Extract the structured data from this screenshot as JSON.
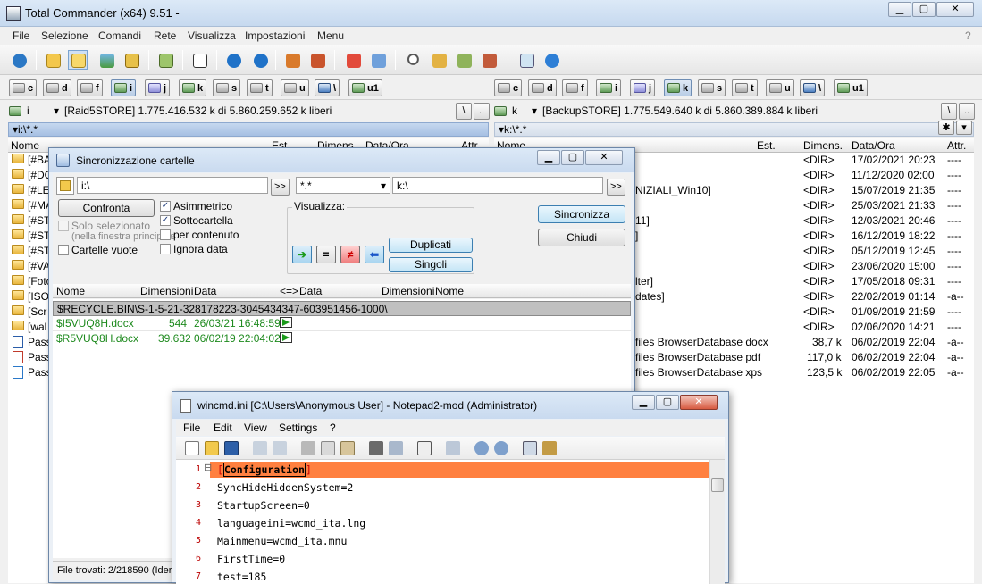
{
  "main": {
    "title": "Total Commander (x64) 9.51 - ",
    "menu": [
      "File",
      "Selezione",
      "Comandi",
      "Rete",
      "Visualizza",
      "Impostazioni",
      "Menu"
    ],
    "help_mark": "?",
    "drives": [
      "c",
      "d",
      "f",
      "i",
      "j",
      "k",
      "s",
      "t",
      "u",
      "\\",
      "u1"
    ],
    "left": {
      "drive": "i",
      "free": "[Raid5STORE]  1.775.416.532 k di 5.860.259.652 k liberi",
      "path": "i:\\*.*",
      "cols": [
        "Nome",
        "Est.",
        "Dimens.",
        "Data/Ora",
        "Attr."
      ],
      "rows": [
        "[#BA",
        "[#DO",
        "[#LE",
        "[#MA",
        "[#ST",
        "[#ST",
        "[#ST",
        "[#VA",
        "[Foto",
        "[ISO",
        "[Scr",
        "[wal",
        "Pass",
        "Pass",
        "Pass"
      ]
    },
    "right": {
      "drive": "k",
      "free": "[BackupSTORE]  1.775.549.640 k di 5.860.389.884 k liberi",
      "path": "k:\\*.*",
      "cols": [
        "Nome",
        "Est.",
        "Dimens.",
        "Data/Ora",
        "Attr."
      ],
      "rows": [
        {
          "name": "",
          "size": "<DIR>",
          "date": "17/02/2021 20:23",
          "attr": "----"
        },
        {
          "name": "",
          "size": "<DIR>",
          "date": "11/12/2020 02:00",
          "attr": "----"
        },
        {
          "name": "NIZIALI_Win10]",
          "size": "<DIR>",
          "date": "15/07/2019 21:35",
          "attr": "----"
        },
        {
          "name": "",
          "size": "<DIR>",
          "date": "25/03/2021 21:33",
          "attr": "----"
        },
        {
          "name": "11]",
          "size": "<DIR>",
          "date": "12/03/2021 20:46",
          "attr": "----"
        },
        {
          "name": "]",
          "size": "<DIR>",
          "date": "16/12/2019 18:22",
          "attr": "----"
        },
        {
          "name": "",
          "size": "<DIR>",
          "date": "05/12/2019 12:45",
          "attr": "----"
        },
        {
          "name": "",
          "size": "<DIR>",
          "date": "23/06/2020 15:00",
          "attr": "----"
        },
        {
          "name": "lter]",
          "size": "<DIR>",
          "date": "17/05/2018 09:31",
          "attr": "----"
        },
        {
          "name": "dates]",
          "size": "<DIR>",
          "date": "22/02/2019 01:14",
          "attr": "-a--"
        },
        {
          "name": "",
          "size": "<DIR>",
          "date": "01/09/2019 21:59",
          "attr": "----"
        },
        {
          "name": "",
          "size": "<DIR>",
          "date": "02/06/2020 14:21",
          "attr": "----"
        },
        {
          "name": "files BrowserDatabase docx",
          "size": "38,7 k",
          "date": "06/02/2019 22:04",
          "attr": "-a--"
        },
        {
          "name": "files BrowserDatabase pdf",
          "size": "117,0 k",
          "date": "06/02/2019 22:04",
          "attr": "-a--"
        },
        {
          "name": "files BrowserDatabase xps",
          "size": "123,5 k",
          "date": "06/02/2019 22:05",
          "attr": "-a--"
        }
      ]
    }
  },
  "sync": {
    "title": "Sincronizzazione cartelle",
    "left_path": "i:\\",
    "filter": "*.*",
    "right_path": "k:\\",
    "browse": ">>",
    "compare": "Confronta",
    "only_selected": "Solo selezionato",
    "only_selected_sub": "(nella finestra principale",
    "empty_dirs": "Cartelle vuote",
    "asymmetric": "Asimmetrico",
    "subfolder": "Sottocartella",
    "by_content": "per contenuto",
    "ignore_date": "Ignora data",
    "view_label": "Visualizza:",
    "duplicates": "Duplicati",
    "singles": "Singoli",
    "synchronize": "Sincronizza",
    "close": "Chiudi",
    "cols": [
      "Nome",
      "Dimensioni",
      "Data",
      "<=>",
      "Data",
      "Dimensioni",
      "Nome"
    ],
    "rows": [
      {
        "name": "$RECYCLE.BIN\\S-1-5-21-328178223-3045434347-603951456-1000\\",
        "size": "",
        "date": ""
      },
      {
        "name": "$I5VUQ8H.docx",
        "size": "544",
        "date": "26/03/21 16:48:59"
      },
      {
        "name": "$R5VUQ8H.docx",
        "size": "39.632",
        "date": "06/02/19 22:04:02"
      }
    ],
    "status": "File trovati: 2/218590  (Ider"
  },
  "notepad": {
    "title": "wincmd.ini [C:\\Users\\Anonymous User] - Notepad2-mod (Administrator)",
    "menu": [
      "File",
      "Edit",
      "View",
      "Settings",
      "?"
    ],
    "lines": [
      "[Configuration]",
      "SyncHideHiddenSystem=2",
      "StartupScreen=0",
      "languageini=wcmd_ita.lng",
      "Mainmenu=wcmd_ita.mnu",
      "FirstTime=0",
      "test=185"
    ],
    "line_numbers": [
      "1",
      "2",
      "3",
      "4",
      "5",
      "6",
      "7"
    ],
    "fold_mark": "⊟"
  },
  "colors": {
    "titlebar": "#c9daef",
    "path_active": "#a6c0e3",
    "sync_green": "#1e8a1e",
    "notepad_current_line": "#ff8040",
    "notepad_line_number": "#b00000"
  }
}
